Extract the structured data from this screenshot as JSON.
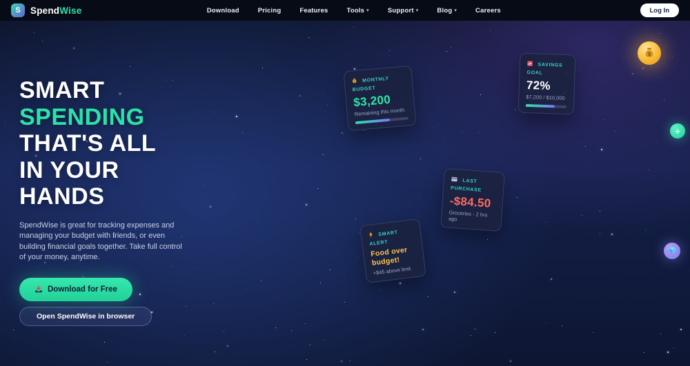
{
  "brand": {
    "logo_letter": "S",
    "name_primary": "Spend",
    "name_secondary": "Wise"
  },
  "nav": {
    "items": [
      {
        "label": "Download",
        "has_dropdown": false
      },
      {
        "label": "Pricing",
        "has_dropdown": false
      },
      {
        "label": "Features",
        "has_dropdown": false
      },
      {
        "label": "Tools",
        "has_dropdown": true
      },
      {
        "label": "Support",
        "has_dropdown": true
      },
      {
        "label": "Blog",
        "has_dropdown": true
      },
      {
        "label": "Careers",
        "has_dropdown": false
      }
    ],
    "login_label": "Log In"
  },
  "hero": {
    "headline_lines": [
      {
        "text": "SMART",
        "accent": false
      },
      {
        "text": "SPENDING",
        "accent": true
      },
      {
        "text": "THAT'S ALL",
        "accent": false
      },
      {
        "text": "IN YOUR",
        "accent": false
      },
      {
        "text": "HANDS",
        "accent": false
      }
    ],
    "description": "SpendWise is great for tracking expenses and managing your budget with friends, or even building financial goals together. Take full control of your money, anytime.",
    "primary_cta": "Download for Free",
    "secondary_cta": "Open SpendWise in browser"
  },
  "cards": {
    "monthly_budget": {
      "icon": "money-bag-icon",
      "label": "MONTHLY BUDGET",
      "value": "$3,200",
      "caption": "Remaining this month",
      "progress_percent": 65
    },
    "savings_goal": {
      "icon": "chart-up-icon",
      "label": "SAVINGS GOAL",
      "value": "72%",
      "caption": "$7,200 / $10,000",
      "progress_percent": 72
    },
    "last_purchase": {
      "icon": "credit-card-icon",
      "label": "LAST PURCHASE",
      "value": "-$84.50",
      "caption": "Groceries - 2 hrs ago"
    },
    "smart_alert": {
      "icon": "lightning-icon",
      "label": "SMART ALERT",
      "value": "Food over budget!",
      "caption": "+$45 above limit"
    }
  },
  "floating_widgets": {
    "coin": "money-bag-coin-icon",
    "add": "plus-icon",
    "gem": "gem-icon"
  },
  "icons": {
    "dropdown_caret": "▾",
    "plus_glyph": "+",
    "download_button": "inbox-tray-icon"
  },
  "colors": {
    "accent_teal": "#2be3a8",
    "label_teal": "#35d4be",
    "value_red": "#ff6b5e",
    "value_yellow": "#ffc44d",
    "coin_orange": "#f7b733",
    "fab_teal": "#23cf9a",
    "fab_purple": "#8377ec",
    "progress_gradient": [
      "#2be3a8",
      "#7b79f9"
    ]
  }
}
